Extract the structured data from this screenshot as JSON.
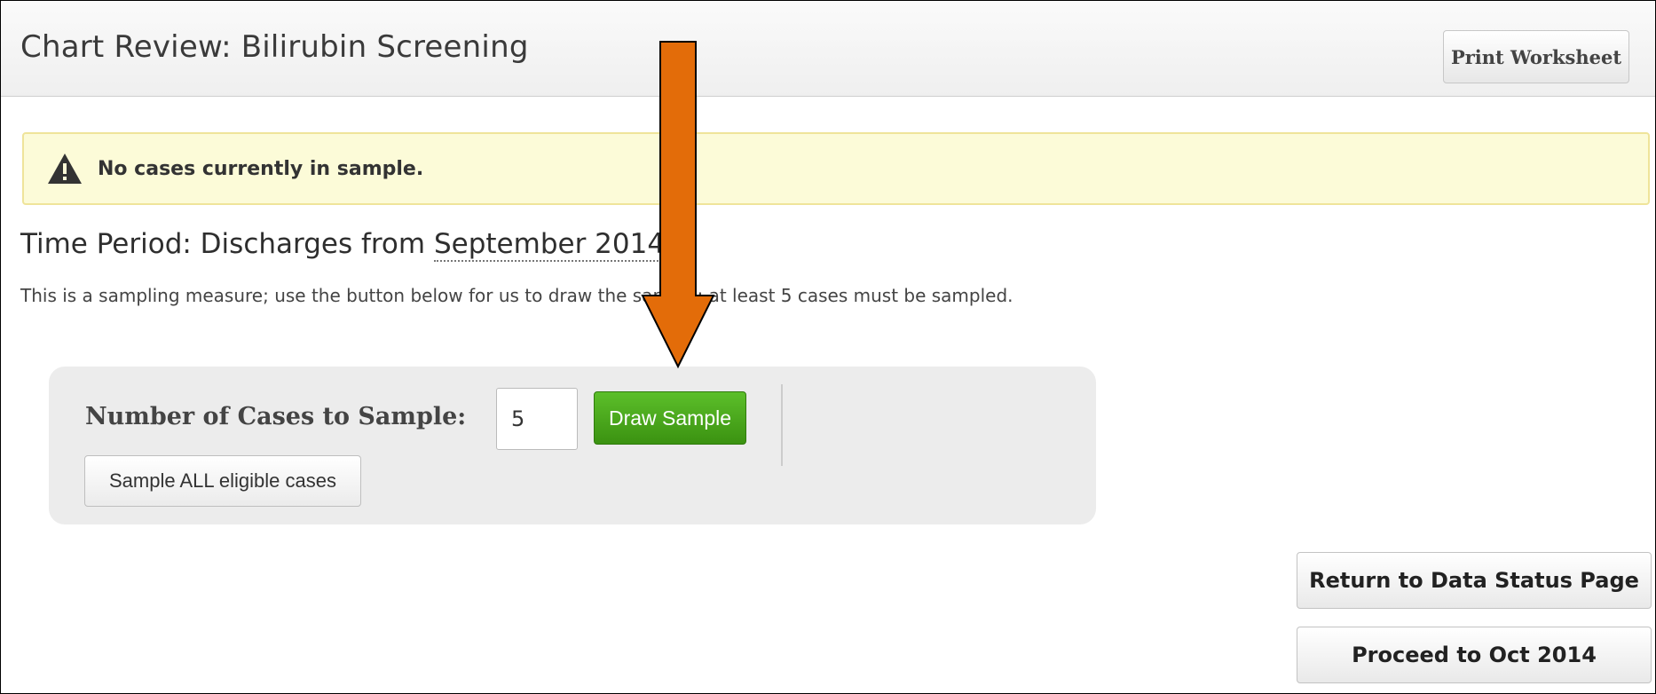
{
  "header": {
    "title": "Chart Review:  Bilirubin Screening",
    "print_label": "Print Worksheet"
  },
  "alert": {
    "icon": "warning-icon",
    "message": "No cases currently in sample."
  },
  "time_period": {
    "prefix": "Time Period: Discharges from ",
    "month": "September 2014"
  },
  "instructions": "This is a sampling measure; use the button below for us to draw the sample; at least 5 cases must be sampled.",
  "sample_panel": {
    "label": "Number of Cases to Sample:",
    "input_value": "5",
    "draw_label": "Draw Sample",
    "sample_all_label": "Sample ALL eligible cases"
  },
  "navigation": {
    "return_label": "Return to Data Status Page",
    "proceed_label": "Proceed to Oct 2014"
  },
  "colors": {
    "arrow": "#e36c09",
    "draw_button": "#4aa81c",
    "alert_background": "#fcfbd8"
  }
}
